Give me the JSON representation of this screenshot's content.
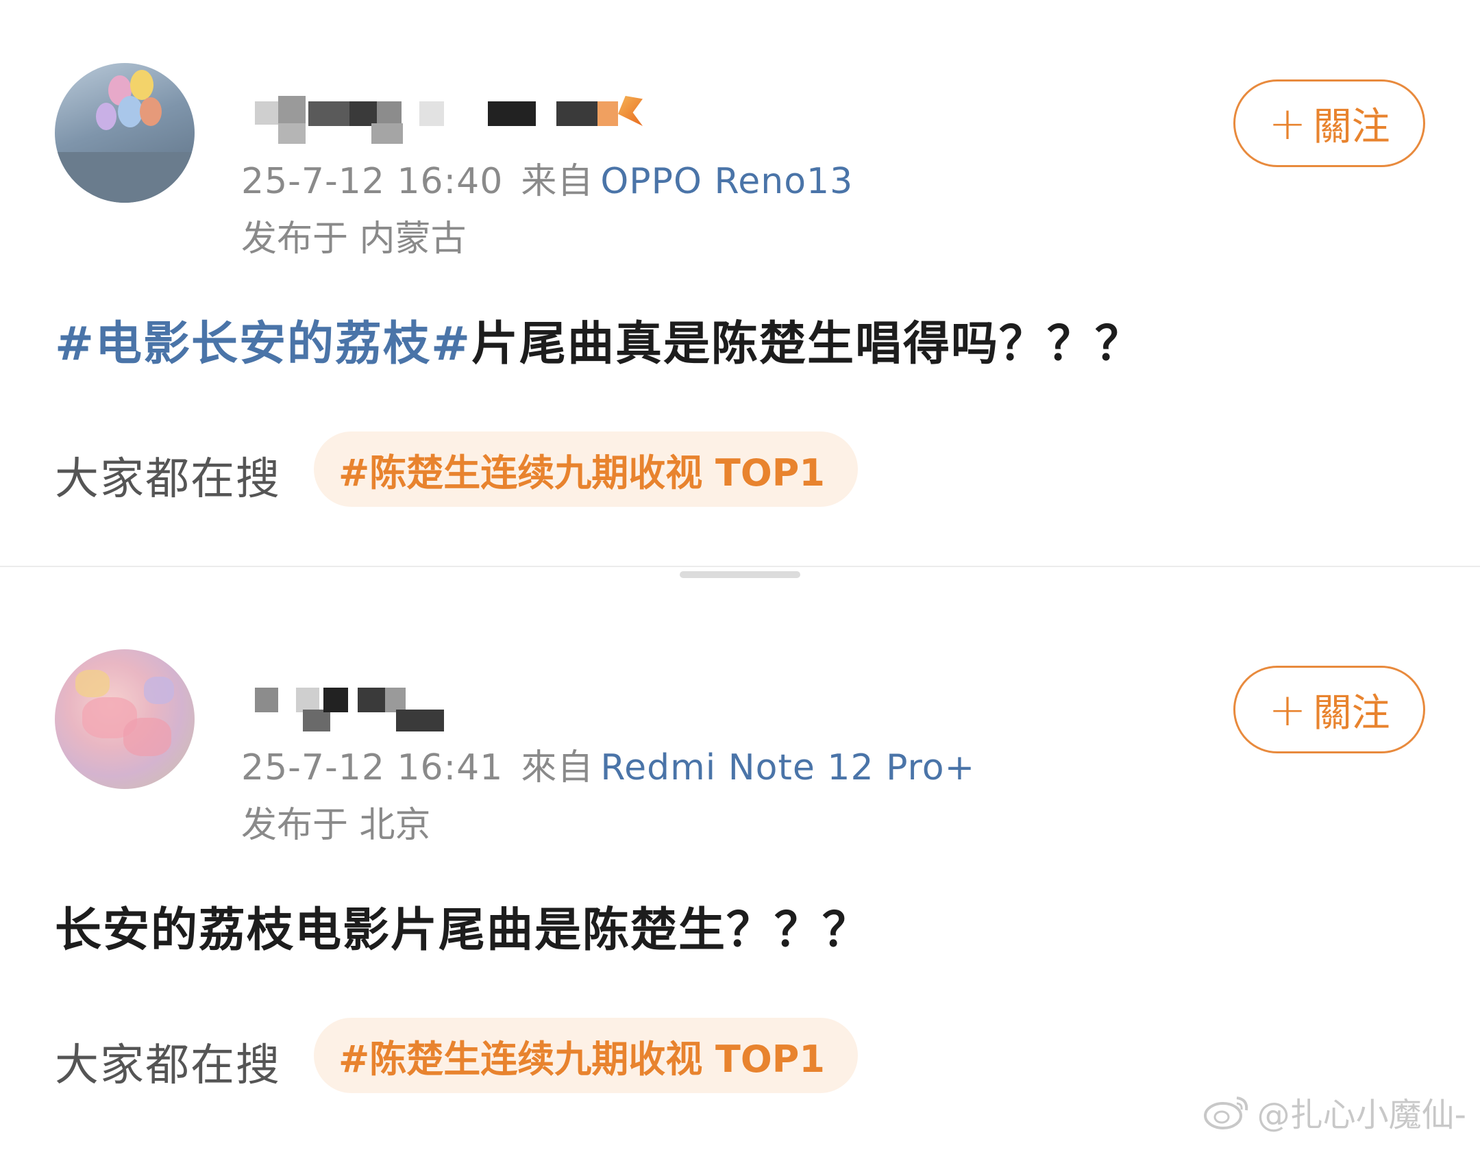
{
  "posts": [
    {
      "timestamp": "25-7-12 16:40",
      "from_label": "来自",
      "device": "OPPO Reno13",
      "location": "发布于 内蒙古",
      "follow_label": "關注",
      "follow_plus": "+",
      "topic": "#电影长安的荔枝#",
      "content": "片尾曲真是陈楚生唱得吗？？？",
      "search_label": "大家都在搜",
      "hot_tag": "#陈楚生连续九期收视 TOP1"
    },
    {
      "timestamp": "25-7-12 16:41",
      "from_label": "來自",
      "device": "Redmi Note 12 Pro+",
      "location": "发布于 北京",
      "follow_label": "關注",
      "follow_plus": "+",
      "topic": "",
      "content": "长安的荔枝电影片尾曲是陈楚生？？？",
      "search_label": "大家都在搜",
      "hot_tag": "#陈楚生连续九期收视 TOP1"
    }
  ],
  "watermark": {
    "text": "@扎心小魔仙-",
    "icon": "weibo-logo-icon"
  },
  "colors": {
    "accent_orange": "#e8832e",
    "link_blue": "#4a74a8",
    "meta_gray": "#8a8a8a",
    "tag_bg": "#fdf1e6"
  }
}
